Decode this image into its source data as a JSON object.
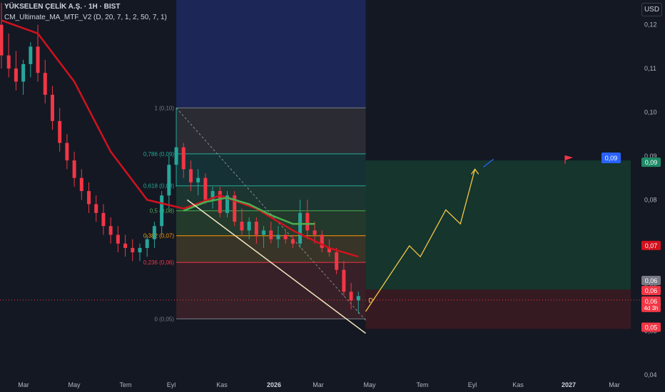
{
  "header": {
    "symbol": "YÜKSELEN ÇELİK A.Ş. · 1H · BIST",
    "indicator": "CM_Ultimate_MA_MTF_V2 (D, 20, 7, 1, 2, 50, 7, 1)",
    "currency": "USD"
  },
  "colors": {
    "background": "#141823",
    "up": "#26a69a",
    "down": "#f23645",
    "ma_red": "#d1121e",
    "ma_green": "#4caf50",
    "trendline": "#f3e5c0",
    "projection": "#f5c842",
    "target_badge": "#2962ff"
  },
  "chart_data": {
    "type": "candlestick",
    "title": "YÜKSELEN ÇELİK A.Ş. · 1H · BIST",
    "ylim": [
      0.04,
      0.125
    ],
    "grid": false,
    "y_ticks": [
      "0,04",
      "0,05",
      "0,06",
      "0,07",
      "0,08",
      "0,09",
      "0,10",
      "0,11",
      "0,12"
    ],
    "x_ticks": [
      "Mar",
      "May",
      "Tem",
      "Eyl",
      "Kas",
      "2026",
      "Mar",
      "May",
      "Tem",
      "Eyl",
      "Kas",
      "2027",
      "Mar"
    ],
    "x_index_range": [
      0,
      100
    ],
    "candles_x_index": [
      0,
      49
    ],
    "candles": [
      [
        0.12,
        0.125,
        0.11,
        0.113
      ],
      [
        0.113,
        0.118,
        0.108,
        0.11
      ],
      [
        0.11,
        0.114,
        0.105,
        0.107
      ],
      [
        0.107,
        0.112,
        0.104,
        0.111
      ],
      [
        0.111,
        0.116,
        0.108,
        0.115
      ],
      [
        0.115,
        0.12,
        0.107,
        0.109
      ],
      [
        0.109,
        0.112,
        0.102,
        0.104
      ],
      [
        0.104,
        0.106,
        0.096,
        0.098
      ],
      [
        0.098,
        0.101,
        0.091,
        0.093
      ],
      [
        0.093,
        0.095,
        0.087,
        0.089
      ],
      [
        0.089,
        0.091,
        0.083,
        0.085
      ],
      [
        0.085,
        0.087,
        0.08,
        0.082
      ],
      [
        0.082,
        0.084,
        0.077,
        0.079
      ],
      [
        0.079,
        0.081,
        0.075,
        0.077
      ],
      [
        0.077,
        0.079,
        0.072,
        0.074
      ],
      [
        0.074,
        0.076,
        0.07,
        0.072
      ],
      [
        0.072,
        0.074,
        0.068,
        0.07
      ],
      [
        0.07,
        0.072,
        0.067,
        0.069
      ],
      [
        0.069,
        0.071,
        0.066,
        0.068
      ],
      [
        0.068,
        0.07,
        0.066,
        0.069
      ],
      [
        0.069,
        0.072,
        0.067,
        0.071
      ],
      [
        0.071,
        0.075,
        0.069,
        0.074
      ],
      [
        0.074,
        0.082,
        0.072,
        0.081
      ],
      [
        0.081,
        0.09,
        0.078,
        0.088
      ],
      [
        0.088,
        0.101,
        0.083,
        0.092
      ],
      [
        0.092,
        0.093,
        0.085,
        0.087
      ],
      [
        0.087,
        0.089,
        0.082,
        0.084
      ],
      [
        0.084,
        0.087,
        0.081,
        0.085
      ],
      [
        0.085,
        0.086,
        0.079,
        0.08
      ],
      [
        0.08,
        0.083,
        0.078,
        0.082
      ],
      [
        0.082,
        0.083,
        0.076,
        0.077
      ],
      [
        0.077,
        0.082,
        0.076,
        0.081
      ],
      [
        0.081,
        0.082,
        0.074,
        0.075
      ],
      [
        0.075,
        0.078,
        0.072,
        0.073
      ],
      [
        0.073,
        0.076,
        0.071,
        0.075
      ],
      [
        0.075,
        0.076,
        0.07,
        0.072
      ],
      [
        0.072,
        0.074,
        0.069,
        0.073
      ],
      [
        0.073,
        0.075,
        0.07,
        0.071
      ],
      [
        0.071,
        0.074,
        0.069,
        0.072
      ],
      [
        0.072,
        0.073,
        0.07,
        0.071
      ],
      [
        0.071,
        0.072,
        0.069,
        0.07
      ],
      [
        0.07,
        0.08,
        0.069,
        0.077
      ],
      [
        0.077,
        0.08,
        0.071,
        0.073
      ],
      [
        0.073,
        0.075,
        0.07,
        0.072
      ],
      [
        0.072,
        0.073,
        0.068,
        0.069
      ],
      [
        0.069,
        0.071,
        0.067,
        0.068
      ],
      [
        0.068,
        0.069,
        0.063,
        0.064
      ],
      [
        0.064,
        0.066,
        0.058,
        0.059
      ],
      [
        0.059,
        0.061,
        0.055,
        0.057
      ],
      [
        0.057,
        0.059,
        0.054,
        0.058
      ]
    ],
    "series": [
      {
        "name": "",
        "color": "red_ma",
        "x": [
          0,
          5,
          10,
          15,
          20,
          25,
          30,
          35,
          40,
          45,
          49
        ],
        "y": [
          0.121,
          0.118,
          0.107,
          0.091,
          0.08,
          0.078,
          0.081,
          0.078,
          0.073,
          0.069,
          0.067
        ]
      },
      {
        "name": "",
        "color": "green_ma",
        "x": [
          25,
          28,
          31,
          34,
          37,
          40,
          43
        ],
        "y": [
          0.0775,
          0.0795,
          0.0805,
          0.079,
          0.0765,
          0.0745,
          0.0745
        ]
      }
    ],
    "fibonacci": {
      "x_range": [
        24,
        50
      ],
      "levels": [
        {
          "label": "1 (0,10)",
          "value": 0.101,
          "color": "#787b86"
        },
        {
          "label": "0,786 (0,09)",
          "value": 0.0905,
          "color": "#22ab94"
        },
        {
          "label": "0,618 (0,08)",
          "value": 0.0832,
          "color": "#22ab94"
        },
        {
          "label": "0,5 (0,08)",
          "value": 0.0775,
          "color": "#4caf50"
        },
        {
          "label": "0,382 (0,07)",
          "value": 0.0718,
          "color": "#ff9800"
        },
        {
          "label": "0,236 (0,06)",
          "value": 0.0657,
          "color": "#f23645"
        },
        {
          "label": "0 (0,05)",
          "value": 0.0528,
          "color": "#787b86"
        }
      ]
    },
    "projection": {
      "label": "D",
      "target_label": "0,09",
      "x": [
        50,
        56,
        57.5,
        61,
        63,
        65
      ],
      "y": [
        0.0545,
        0.0695,
        0.067,
        0.0777,
        0.0745,
        0.087
      ],
      "target_flag_y": 0.0895,
      "target_zone": [
        0.0595,
        0.089
      ],
      "stop_zone": [
        0.0505,
        0.0595
      ]
    },
    "price_labels": [
      {
        "text": "0,09",
        "value": 0.0885,
        "color": "#1c8a64"
      },
      {
        "text": "0,07",
        "value": 0.0695,
        "color": "#d1121e"
      },
      {
        "text": "0,06",
        "value": 0.0615,
        "color": "#787b86"
      },
      {
        "text": "0,06",
        "value": 0.0592,
        "color": "#f23645"
      },
      {
        "text": "0,06",
        "value": 0.0568,
        "color": "#f23645",
        "sub": "4d 3h"
      },
      {
        "text": "0,05",
        "value": 0.0508,
        "color": "#f23645"
      }
    ]
  }
}
